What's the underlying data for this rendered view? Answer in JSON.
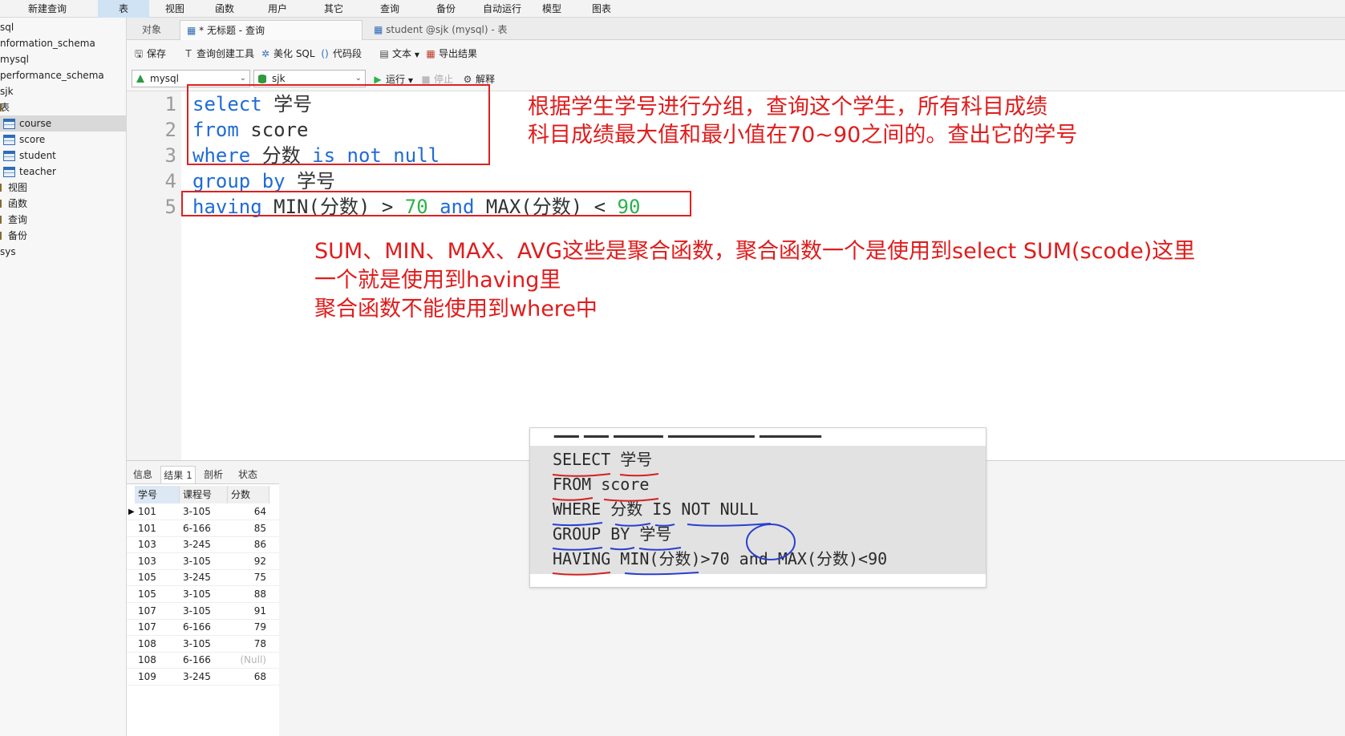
{
  "menubar": {
    "items": [
      "新建查询",
      "表",
      "视图",
      "函数",
      "用户",
      "其它",
      "查询",
      "备份",
      "自动运行",
      "模型",
      "图表"
    ],
    "active_index": 1
  },
  "sidebar": {
    "items": [
      {
        "label": "sql",
        "icon": "database-icon"
      },
      {
        "label": "nformation_schema",
        "icon": "database-icon"
      },
      {
        "label": "mysql",
        "icon": "database-icon"
      },
      {
        "label": "performance_schema",
        "icon": "database-icon"
      },
      {
        "label": "sjk",
        "icon": "database-icon"
      },
      {
        "label": "表",
        "icon": "tables-folder-icon"
      },
      {
        "label": "course",
        "icon": "table-icon"
      },
      {
        "label": "score",
        "icon": "table-icon"
      },
      {
        "label": "student",
        "icon": "table-icon"
      },
      {
        "label": "teacher",
        "icon": "table-icon"
      },
      {
        "label": "视图",
        "icon": "view-icon"
      },
      {
        "label": "函数",
        "icon": "function-icon"
      },
      {
        "label": "查询",
        "icon": "query-icon"
      },
      {
        "label": "备份",
        "icon": "backup-icon"
      },
      {
        "label": "sys",
        "icon": "database-icon"
      }
    ],
    "selected": "course"
  },
  "tabs": {
    "objects": "对象",
    "query_tab": "* 无标题 - 查询",
    "table_tab": "student @sjk (mysql) - 表"
  },
  "toolbar": {
    "save": "保存",
    "query_builder": "查询创建工具",
    "beautify": "美化 SQL",
    "snippet": "代码段",
    "text": "文本",
    "export": "导出结果",
    "connection": "mysql",
    "database": "sjk",
    "run": "运行",
    "stop": "停止",
    "explain": "解释"
  },
  "editor": {
    "lines": [
      {
        "num": "1",
        "tokens": [
          {
            "t": "select",
            "c": "kw"
          },
          {
            "t": " 学号",
            "c": ""
          }
        ]
      },
      {
        "num": "2",
        "tokens": [
          {
            "t": "from",
            "c": "kw"
          },
          {
            "t": " score",
            "c": ""
          }
        ]
      },
      {
        "num": "3",
        "tokens": [
          {
            "t": "where",
            "c": "kw"
          },
          {
            "t": " 分数 ",
            "c": ""
          },
          {
            "t": "is not null",
            "c": "kw"
          }
        ]
      },
      {
        "num": "4",
        "tokens": [
          {
            "t": "group by",
            "c": "kw"
          },
          {
            "t": " 学号",
            "c": ""
          }
        ]
      },
      {
        "num": "5",
        "tokens": [
          {
            "t": "having",
            "c": "kw"
          },
          {
            "t": " MIN(分数) > ",
            "c": ""
          },
          {
            "t": "70",
            "c": "num"
          },
          {
            "t": " ",
            "c": ""
          },
          {
            "t": "and",
            "c": "kw"
          },
          {
            "t": " MAX(分数) < ",
            "c": ""
          },
          {
            "t": "90",
            "c": "num"
          }
        ]
      }
    ]
  },
  "annotations": {
    "top_line1": "根据学生学号进行分组，查询这个学生，所有科目成绩",
    "top_line2": "科目成绩最大值和最小值在70~90之间的。查出它的学号",
    "mid_line1": "SUM、MIN、MAX、AVG这些是聚合函数，聚合函数一个是使用到select SUM(scode)这里",
    "mid_line2": "一个就是使用到having里",
    "mid_line3": "聚合函数不能使用到where中"
  },
  "pasted_image": {
    "lines": [
      "SELECT 学号",
      "FROM score",
      "WHERE 分数 IS NOT NULL",
      "GROUP BY 学号",
      "HAVING MIN(分数)>70 and MAX(分数)<90"
    ]
  },
  "results": {
    "tabs": [
      "信息",
      "结果 1",
      "剖析",
      "状态"
    ],
    "active_tab": 1,
    "columns": [
      "学号",
      "课程号",
      "分数"
    ],
    "rows": [
      [
        "101",
        "3-105",
        "64"
      ],
      [
        "101",
        "6-166",
        "85"
      ],
      [
        "103",
        "3-245",
        "86"
      ],
      [
        "103",
        "3-105",
        "92"
      ],
      [
        "105",
        "3-245",
        "75"
      ],
      [
        "105",
        "3-105",
        "88"
      ],
      [
        "107",
        "3-105",
        "91"
      ],
      [
        "107",
        "6-166",
        "79"
      ],
      [
        "108",
        "3-105",
        "78"
      ],
      [
        "108",
        "6-166",
        "(Null)"
      ],
      [
        "109",
        "3-245",
        "68"
      ]
    ]
  },
  "colors": {
    "keyword": "#1f6bd6",
    "number": "#2bb34a",
    "annotation_red": "#e01c1c",
    "selection": "#cfe3f5"
  }
}
